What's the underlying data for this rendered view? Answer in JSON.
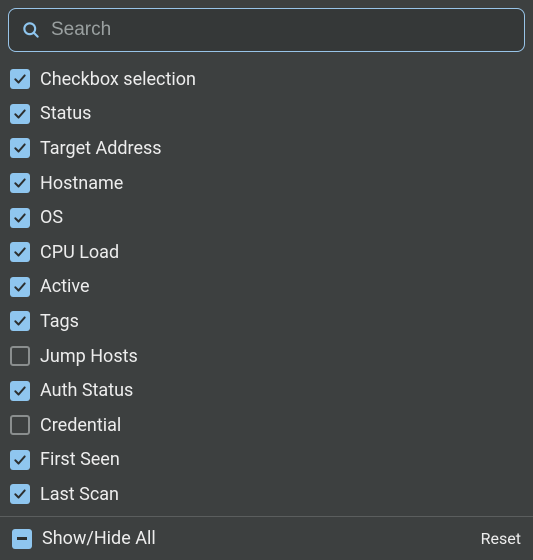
{
  "search": {
    "placeholder": "Search",
    "value": ""
  },
  "items": [
    {
      "label": "Checkbox selection",
      "checked": true
    },
    {
      "label": "Status",
      "checked": true
    },
    {
      "label": "Target Address",
      "checked": true
    },
    {
      "label": "Hostname",
      "checked": true
    },
    {
      "label": "OS",
      "checked": true
    },
    {
      "label": "CPU Load",
      "checked": true
    },
    {
      "label": "Active",
      "checked": true
    },
    {
      "label": "Tags",
      "checked": true
    },
    {
      "label": "Jump Hosts",
      "checked": false
    },
    {
      "label": "Auth Status",
      "checked": true
    },
    {
      "label": "Credential",
      "checked": false
    },
    {
      "label": "First Seen",
      "checked": true
    },
    {
      "label": "Last Scan",
      "checked": true
    }
  ],
  "footer": {
    "toggle_label": "Show/Hide All",
    "toggle_state": "indeterminate",
    "reset_label": "Reset"
  },
  "colors": {
    "accent": "#8fc6ef",
    "background": "#3d4040",
    "search_border": "#98c4e8"
  }
}
